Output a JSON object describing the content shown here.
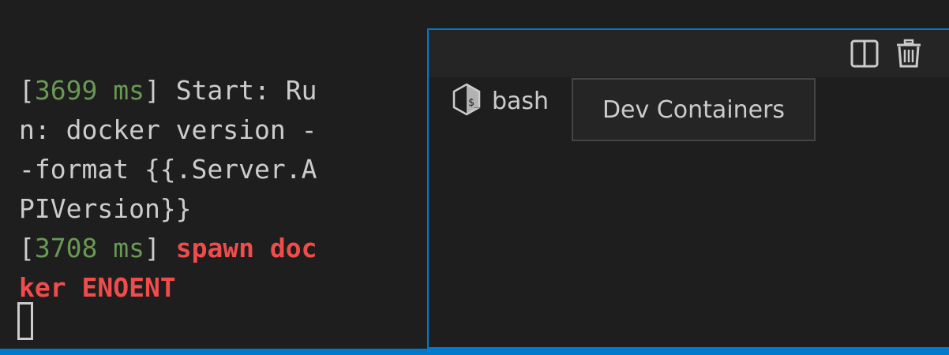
{
  "terminal": {
    "lines": [
      {
        "bracket_open": "[",
        "ms": "3699 ms",
        "bracket_close": "]",
        "rest": " Start: Ru"
      },
      {
        "text": "n: docker version -"
      },
      {
        "text": "-format {{.Server.A"
      },
      {
        "text": "PIVersion}}"
      },
      {
        "bracket_open": "[",
        "ms": "3708 ms",
        "bracket_close": "]",
        "space": " ",
        "error": "spawn doc"
      },
      {
        "error": "ker ENOENT"
      }
    ]
  },
  "tabs_panel": {
    "tabs": [
      {
        "label": "bash",
        "icon": "terminal-bash-icon"
      }
    ],
    "toolbar": {
      "split_icon": "split-terminal-icon",
      "delete_icon": "trash-icon"
    }
  },
  "tooltip": {
    "text": "Dev Containers"
  },
  "colors": {
    "background": "#1e1e1e",
    "toolbar": "#252526",
    "accent": "#007acc",
    "timestamp": "#6a9955",
    "error": "#f14c4c",
    "text": "#cccccc"
  }
}
